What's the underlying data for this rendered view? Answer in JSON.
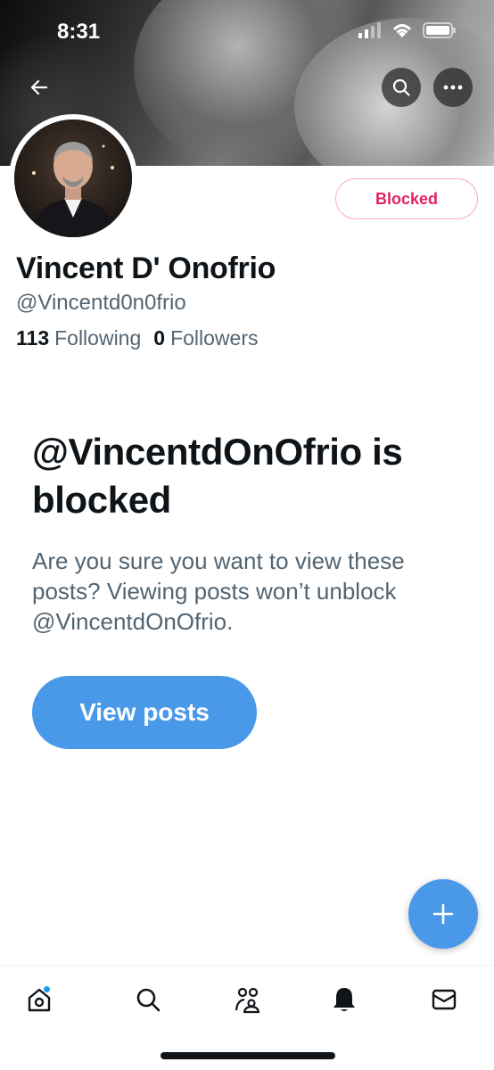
{
  "status_bar": {
    "time": "8:31"
  },
  "profile": {
    "name": "Vincent D' Onofrio",
    "handle": "@Vincentd0n0frio",
    "following_count": "113",
    "following_label": "Following",
    "followers_count": "0",
    "followers_label": "Followers",
    "blocked_button_label": "Blocked"
  },
  "blocked_notice": {
    "title": "@VincentdOnOfrio is blocked",
    "description": "Are you sure you want to view these posts? Viewing posts won’t unblock @VincentdOnOfrio.",
    "view_posts_label": "View posts"
  },
  "colors": {
    "accent": "#4a99e9",
    "blocked_red": "#e0245e"
  },
  "icons": {
    "back": "arrow-left-icon",
    "search": "search-icon",
    "more": "more-icon",
    "fab": "plus-icon",
    "nav": [
      "home-icon",
      "search-icon",
      "communities-icon",
      "notifications-icon",
      "messages-icon"
    ]
  }
}
